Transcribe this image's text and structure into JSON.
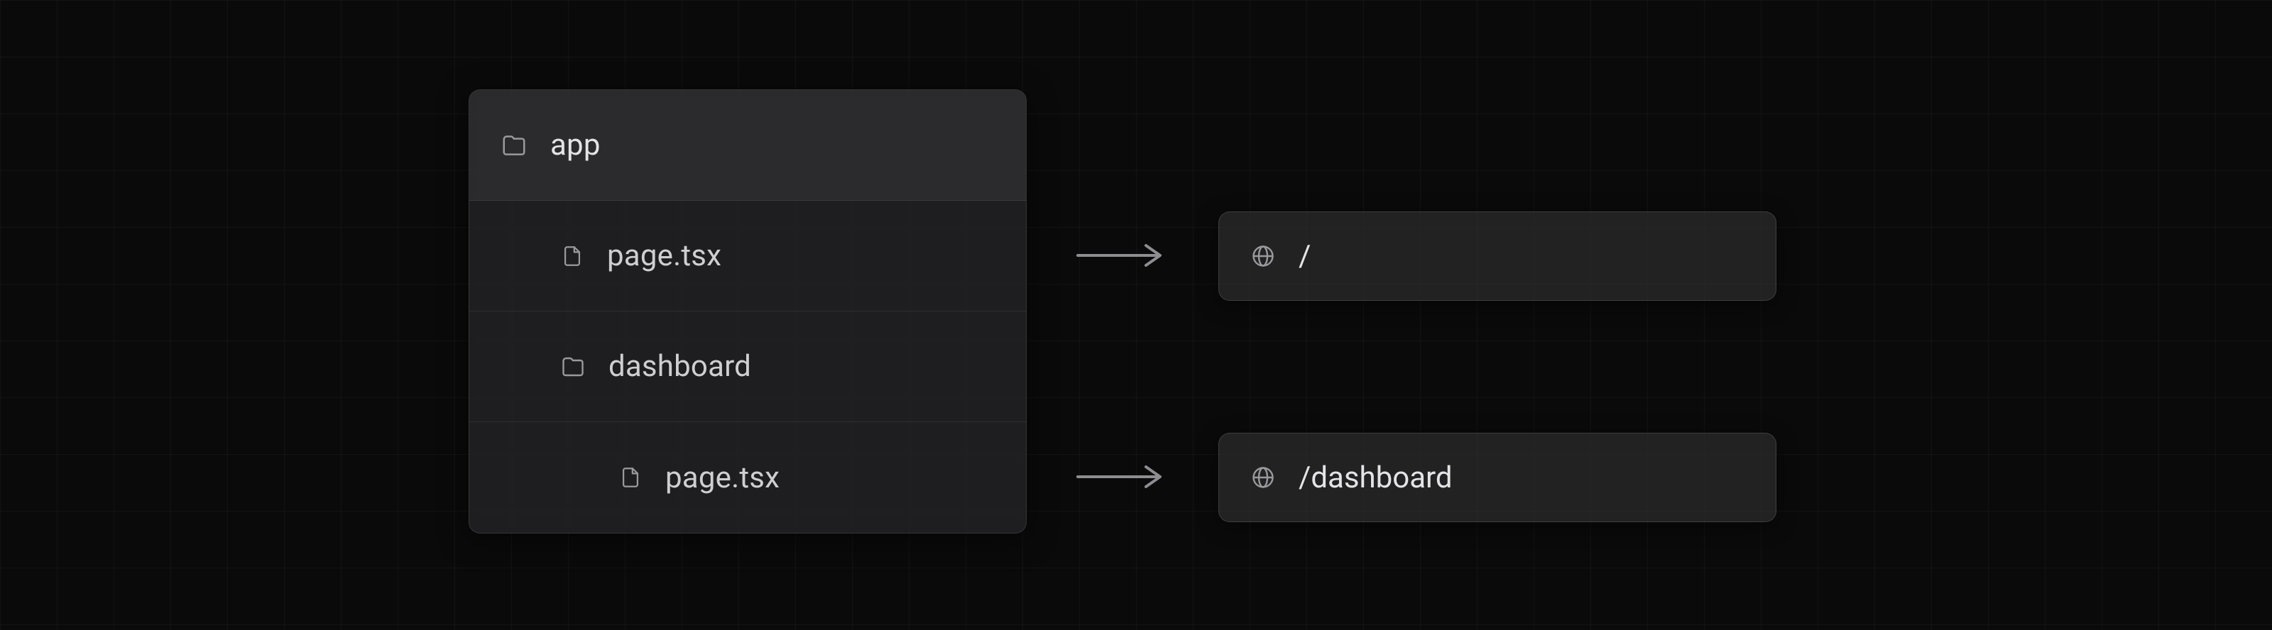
{
  "tree": {
    "root": {
      "label": "app",
      "icon": "folder-icon"
    },
    "rows": [
      {
        "label": "page.tsx",
        "icon": "file-icon",
        "indent": 1
      },
      {
        "label": "dashboard",
        "icon": "folder-icon",
        "indent": 1
      },
      {
        "label": "page.tsx",
        "icon": "file-icon",
        "indent": 2
      }
    ]
  },
  "routes": [
    {
      "path": "/"
    },
    {
      "path": "/dashboard"
    }
  ],
  "colors": {
    "bg": "#0a0a0a",
    "panel": "#2c2c2e",
    "text": "#e4e4e6",
    "muted": "#8e8e92",
    "border": "rgba(255,255,255,0.12)"
  }
}
